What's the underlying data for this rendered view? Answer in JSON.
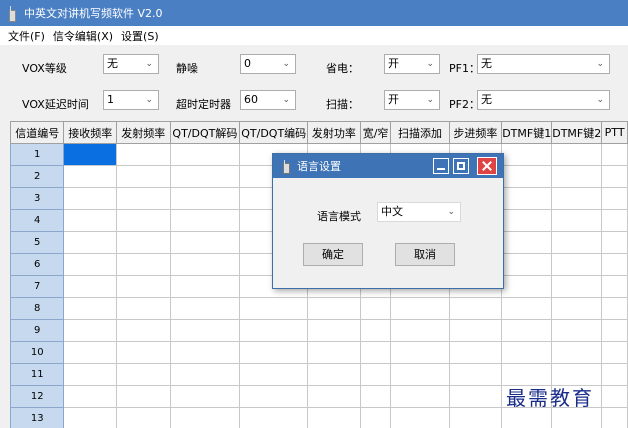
{
  "window": {
    "title": "中英文对讲机写频软件 V2.0"
  },
  "menu": [
    "文件(F)",
    "信令编辑(X)",
    "设置(S)"
  ],
  "settings": {
    "vox_level": {
      "label": "VOX等级",
      "value": "无"
    },
    "squelch": {
      "label": "静噪",
      "value": "0"
    },
    "power_save": {
      "label": "省电：",
      "value": "开"
    },
    "pf1": {
      "label": "PF1：",
      "value": "无"
    },
    "vox_delay": {
      "label": "VOX延迟时间",
      "value": "1"
    },
    "timeout": {
      "label": "超时定时器",
      "value": "60"
    },
    "scan": {
      "label": "扫描：",
      "value": "开"
    },
    "pf2": {
      "label": "PF2：",
      "value": "无"
    },
    "dropdown_arrow": "⌄"
  },
  "table": {
    "headers": [
      "信道编号",
      "接收频率",
      "发射频率",
      "QT/DQT解码",
      "QT/DQT编码",
      "发射功率",
      "宽/窄",
      "扫描添加",
      "步进频率",
      "DTMF键1",
      "DTMF键2",
      "PTT"
    ],
    "rows": [
      "1",
      "2",
      "3",
      "4",
      "5",
      "6",
      "7",
      "8",
      "9",
      "10",
      "11",
      "12",
      "13"
    ]
  },
  "dialog": {
    "title": "语言设置",
    "mode_label": "语言模式",
    "mode_value": "中文",
    "ok_label": "确定",
    "cancel_label": "取消"
  },
  "watermark": "最需教育"
}
